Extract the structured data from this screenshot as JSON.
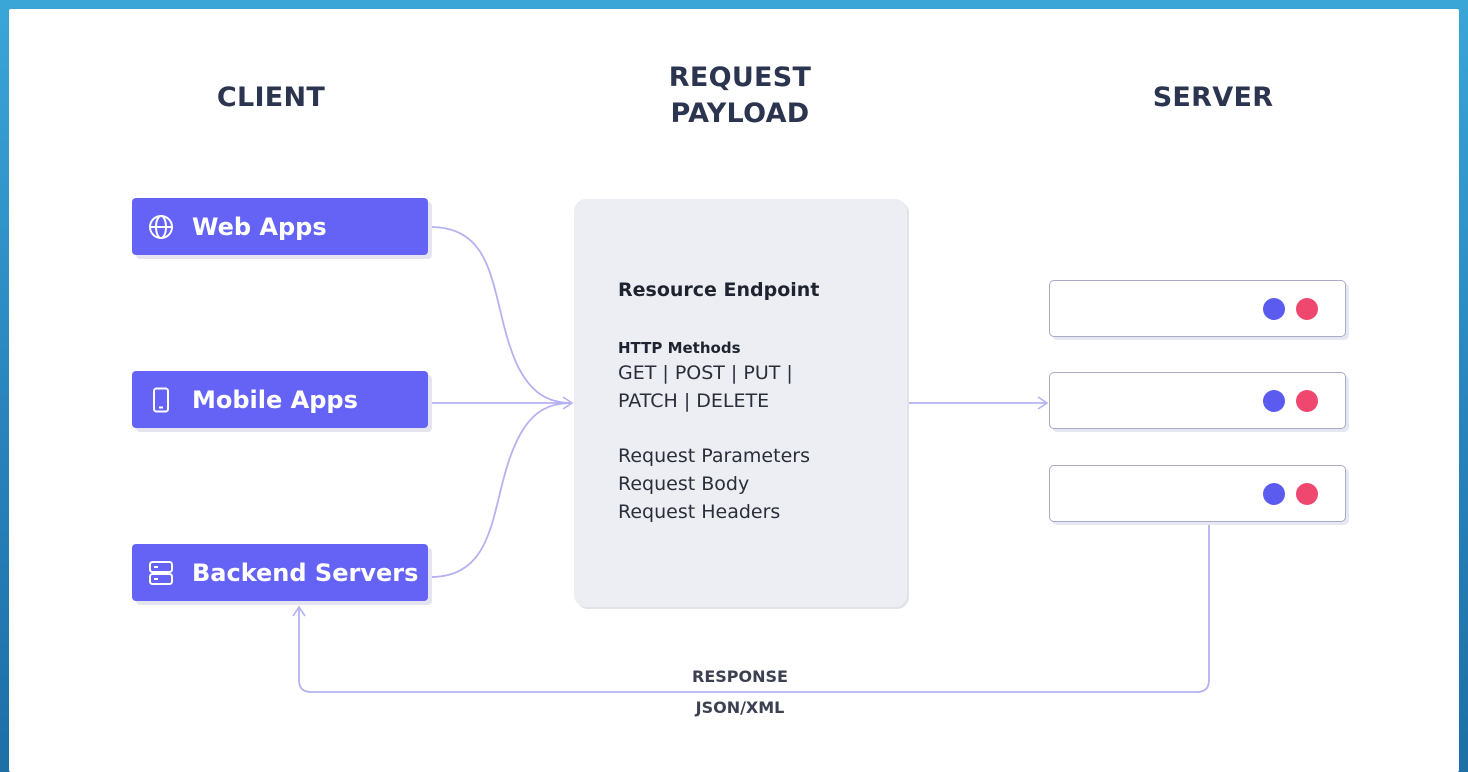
{
  "columns": {
    "client": "CLIENT",
    "request_line1": "REQUEST",
    "request_line2": "PAYLOAD",
    "server": "SERVER"
  },
  "clients": [
    {
      "label": "Web Apps",
      "icon": "globe-icon"
    },
    {
      "label": "Mobile Apps",
      "icon": "mobile-icon"
    },
    {
      "label": "Backend Servers",
      "icon": "server-stack-icon"
    }
  ],
  "endpoint": {
    "title": "Resource Endpoint",
    "methods_label": "HTTP Methods",
    "methods_line1": "GET | POST | PUT |",
    "methods_line2": "PATCH | DELETE",
    "params": "Request Parameters",
    "body": "Request Body",
    "headers": "Request Headers"
  },
  "response": {
    "line1": "RESPONSE",
    "line2": "JSON/XML"
  },
  "colors": {
    "client_fill": "#6563f5",
    "connector": "#b5b2f0",
    "dot_blue": "#5b5bf0",
    "dot_pink": "#f0476f",
    "card": "#eceef3",
    "border": "#2b8fc4"
  }
}
